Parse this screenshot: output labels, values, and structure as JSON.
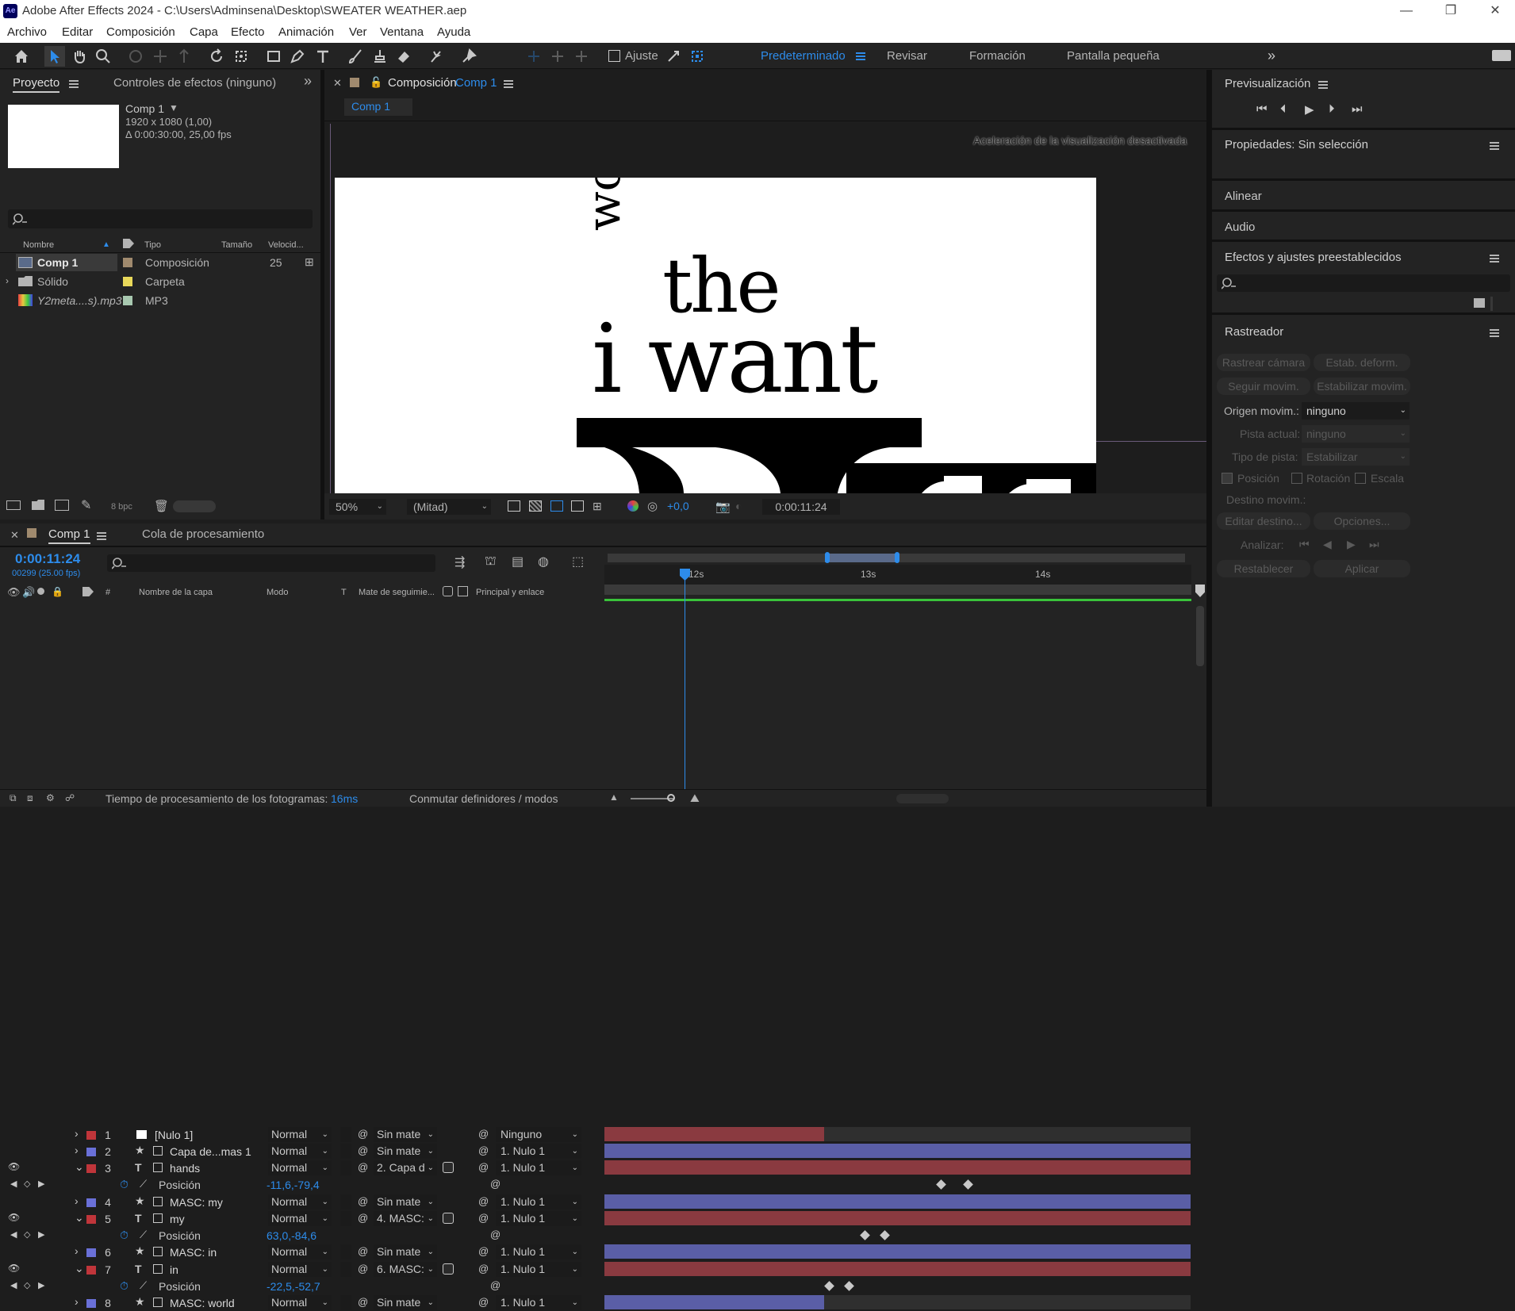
{
  "window": {
    "title": "Adobe After Effects 2024 - C:\\Users\\Adminsena\\Desktop\\SWEATER WEATHER.aep",
    "logo": "Ae"
  },
  "menu": [
    "Archivo",
    "Editar",
    "Composición",
    "Capa",
    "Efecto",
    "Animación",
    "Ver",
    "Ventana",
    "Ayuda"
  ],
  "toolbar": {
    "snap_label": "Ajuste",
    "workspaces": [
      "Predeterminado",
      "Revisar",
      "Formación",
      "Pantalla pequeña"
    ]
  },
  "project": {
    "tab_project": "Proyecto",
    "tab_effects": "Controles de efectos (ninguno)",
    "comp_name": "Comp 1",
    "comp_dims": "1920 x 1080 (1,00)",
    "comp_duration": "Δ 0:00:30:00, 25,00 fps",
    "columns": {
      "name": "Nombre",
      "type": "Tipo",
      "size": "Tamaño",
      "rate": "Velocid..."
    },
    "items": [
      {
        "name": "Comp 1",
        "type": "Composición",
        "rate": "25",
        "color": "#a08a6e"
      },
      {
        "name": "Sólido",
        "type": "Carpeta",
        "rate": "",
        "color": "#e8d85a"
      },
      {
        "name": "Y2meta....s).mp3",
        "type": "MP3",
        "rate": "",
        "color": "#a8c8b0"
      }
    ],
    "bpc": "8 bpc"
  },
  "composition": {
    "tab_label": "Composición",
    "comp_link": "Comp 1",
    "breadcrumb": "Comp 1",
    "accel_msg": "Aceleración de la visualización desactivada",
    "artwork": {
      "word_world": "world",
      "word_the": "the",
      "word_iwant": "i want"
    },
    "zoom": "50%",
    "resolution": "(Mitad)",
    "exposure": "+0,0",
    "timecode": "0:00:11:24"
  },
  "preview": {
    "title": "Previsualización"
  },
  "properties": {
    "title": "Propiedades: Sin selección"
  },
  "align": {
    "title": "Alinear"
  },
  "audio": {
    "title": "Audio"
  },
  "effects_presets": {
    "title": "Efectos y ajustes preestablecidos"
  },
  "tracker": {
    "title": "Rastreador",
    "btn_track_camera": "Rastrear cámara",
    "btn_warp_stab": "Estab. deform.",
    "btn_track_motion": "Seguir movim.",
    "btn_stabilize": "Estabilizar movim.",
    "motion_source_label": "Origen movim.:",
    "motion_source_value": "ninguno",
    "current_track_label": "Pista actual:",
    "current_track_value": "ninguno",
    "track_type_label": "Tipo de pista:",
    "track_type_value": "Estabilizar",
    "chk_position": "Posición",
    "chk_rotation": "Rotación",
    "chk_scale": "Escala",
    "target_label": "Destino movim.:",
    "btn_edit_target": "Editar destino...",
    "btn_options": "Opciones...",
    "analyze_label": "Analizar:",
    "btn_reset": "Restablecer",
    "btn_apply": "Aplicar"
  },
  "timeline": {
    "tab_comp": "Comp 1",
    "tab_render": "Cola de procesamiento",
    "timecode": "0:00:11:24",
    "frame_info": "00299 (25.00 fps)",
    "headers": {
      "layer_name": "Nombre de la capa",
      "mode": "Modo",
      "t": "T",
      "matte": "Mate de seguimie...",
      "parent": "Principal y enlace",
      "num": "#"
    },
    "ruler": [
      "12s",
      "13s",
      "14s"
    ],
    "layers": [
      {
        "num": "1",
        "name": "[Nulo 1]",
        "mode": "Normal",
        "matte": "Sin mate",
        "parent": "Ninguno",
        "color": "#c0353a",
        "kind": "null",
        "eye": false,
        "twirl": "›"
      },
      {
        "num": "2",
        "name": "Capa de...mas 1",
        "mode": "Normal",
        "matte": "Sin mate",
        "parent": "1. Nulo 1",
        "color": "#6a70d8",
        "kind": "shape",
        "eye": false,
        "twirl": "›"
      },
      {
        "num": "3",
        "name": "hands",
        "mode": "Normal",
        "matte": "2. Capa d",
        "parent": "1. Nulo 1",
        "color": "#c0353a",
        "kind": "text",
        "eye": true,
        "twirl": "⌄"
      },
      {
        "prop": true,
        "name": "Posición",
        "value": "-11,6,-79,4"
      },
      {
        "num": "4",
        "name": "MASC: my",
        "mode": "Normal",
        "matte": "Sin mate",
        "parent": "1. Nulo 1",
        "color": "#6a70d8",
        "kind": "shape",
        "eye": false,
        "twirl": "›"
      },
      {
        "num": "5",
        "name": "my",
        "mode": "Normal",
        "matte": "4. MASC:",
        "parent": "1. Nulo 1",
        "color": "#c0353a",
        "kind": "text",
        "eye": true,
        "twirl": "⌄"
      },
      {
        "prop": true,
        "name": "Posición",
        "value": "63,0,-84,6"
      },
      {
        "num": "6",
        "name": "MASC: in",
        "mode": "Normal",
        "matte": "Sin mate",
        "parent": "1. Nulo 1",
        "color": "#6a70d8",
        "kind": "shape",
        "eye": false,
        "twirl": "›"
      },
      {
        "num": "7",
        "name": "in",
        "mode": "Normal",
        "matte": "6. MASC:",
        "parent": "1. Nulo 1",
        "color": "#c0353a",
        "kind": "text",
        "eye": true,
        "twirl": "⌄"
      },
      {
        "prop": true,
        "name": "Posición",
        "value": "-22,5,-52,7"
      },
      {
        "num": "8",
        "name": "MASC: world",
        "mode": "Normal",
        "matte": "Sin mate",
        "parent": "1. Nulo 1",
        "color": "#6a70d8",
        "kind": "shape",
        "eye": false,
        "twirl": "›"
      }
    ],
    "status_render_label": "Tiempo de procesamiento de los fotogramas:",
    "status_render_value": "16ms",
    "status_toggle": "Conmutar definidores / modos"
  }
}
